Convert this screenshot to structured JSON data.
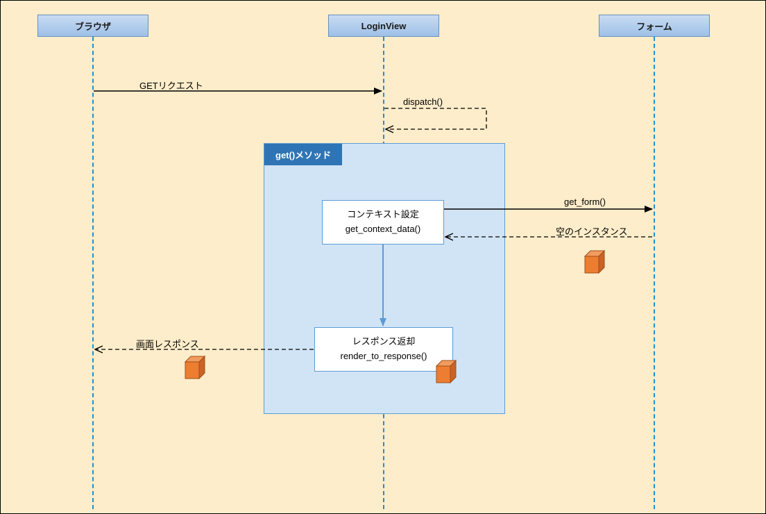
{
  "participants": {
    "browser": "ブラウザ",
    "loginview": "LoginView",
    "form": "フォーム"
  },
  "messages": {
    "get_request": "GETリクエスト",
    "dispatch": "dispatch()",
    "get_form": "get_form()",
    "empty_instance": "空のインスタンス",
    "screen_response": "画面レスポンス"
  },
  "frame": {
    "title": "get()メソッド"
  },
  "boxes": {
    "context": {
      "title": "コンテキスト設定",
      "method": "get_context_data()"
    },
    "render": {
      "title": "レスポンス返却",
      "method": "render_to_response()"
    }
  }
}
